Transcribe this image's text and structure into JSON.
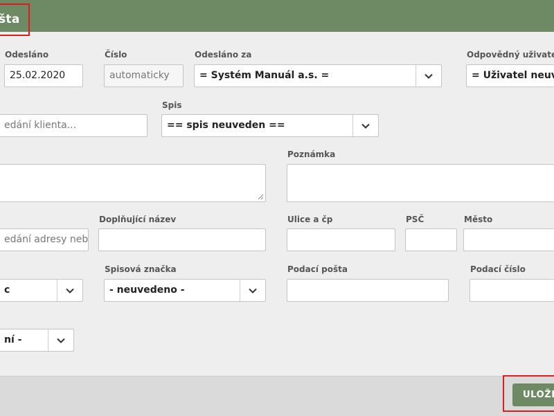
{
  "header": {
    "title": "šta"
  },
  "fields": {
    "odeslano": {
      "label": "Odesláno",
      "value": "25.02.2020"
    },
    "cislo": {
      "label": "Číslo",
      "value": "automaticky"
    },
    "odeslano_za": {
      "label": "Odesláno za",
      "value": "= Systém Manuál a.s. ="
    },
    "odpovedny_uzivatel": {
      "label": "Odpovědný uživatel",
      "value": "= Uživatel neuvedeno"
    },
    "klient": {
      "placeholder": "edání klienta..."
    },
    "spis": {
      "label": "Spis",
      "value": "== spis neuveden =="
    },
    "poznamka": {
      "label": "Poznámka",
      "value": ""
    },
    "adresa": {
      "placeholder": "edání adresy nebo"
    },
    "doplnujici_nazev": {
      "label": "Doplňující název",
      "value": ""
    },
    "ulice": {
      "label": "Ulice a čp",
      "value": ""
    },
    "psc": {
      "label": "PSČ",
      "value": ""
    },
    "mesto": {
      "label": "Město",
      "value": ""
    },
    "typ": {
      "value": "c"
    },
    "spisova_znacka": {
      "label": "Spisová značka",
      "value": "- neuvedeno -"
    },
    "podaci_posta": {
      "label": "Podací pošta",
      "value": ""
    },
    "podaci_cislo": {
      "label": "Podací číslo",
      "value": ""
    },
    "dalsi": {
      "value": "ní -"
    }
  },
  "footer": {
    "save_label": "ULOŽIT"
  },
  "colors": {
    "accent": "#6e8a64",
    "highlight": "#e01b1b"
  }
}
